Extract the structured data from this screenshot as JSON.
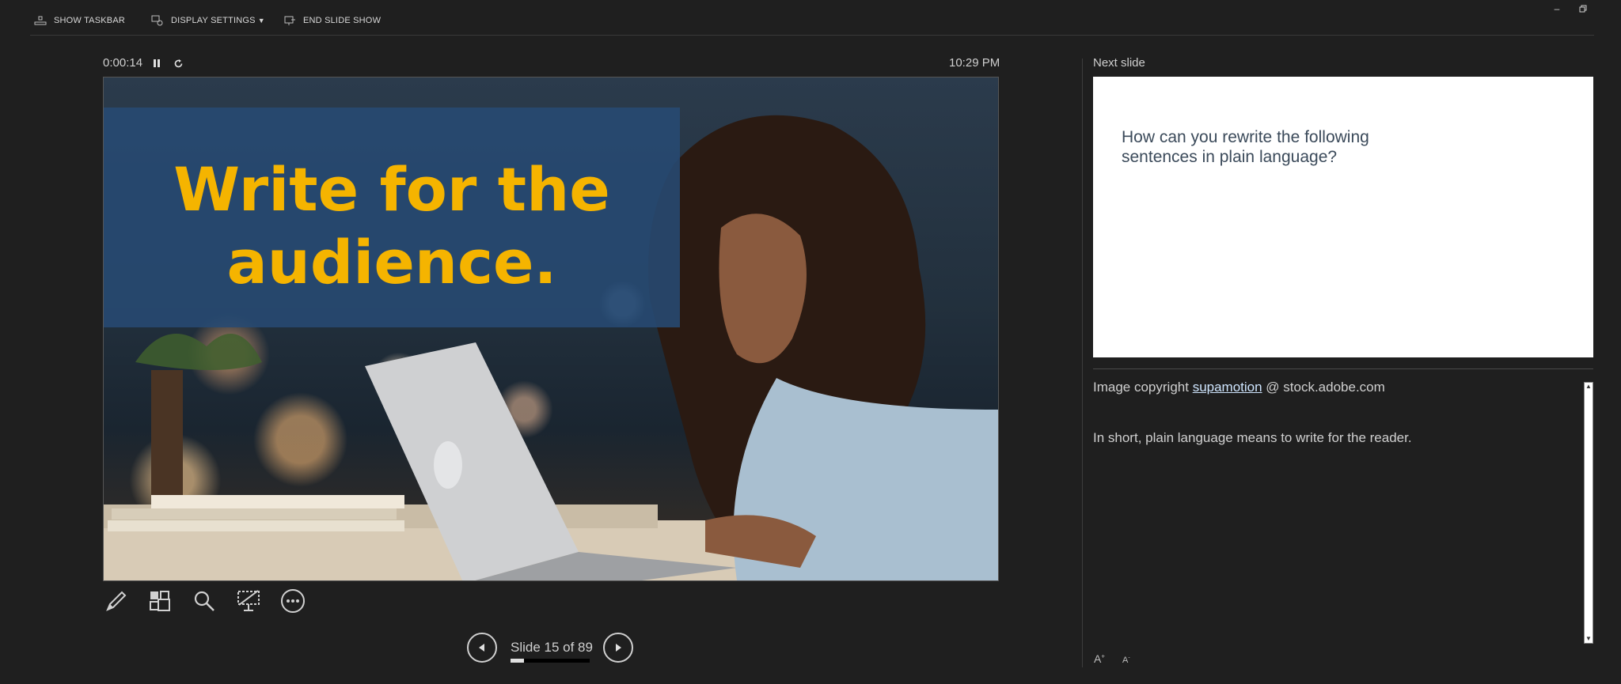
{
  "toolbar": {
    "show_taskbar": "SHOW TASKBAR",
    "display_settings": "DISPLAY SETTINGS",
    "end_slide_show": "END SLIDE SHOW"
  },
  "window_controls": [
    "minimize",
    "restore"
  ],
  "timer": {
    "elapsed": "0:00:14",
    "clock": "10:29 PM"
  },
  "current_slide": {
    "title": "Write for the\naudience.",
    "title_color": "#f5b400",
    "band_color": "#274a73"
  },
  "slide_tools": [
    "pen-icon",
    "see-all-slides-icon",
    "zoom-icon",
    "black-screen-icon",
    "more-options-icon"
  ],
  "navigation": {
    "slide_label": "Slide 15 of 89",
    "current": 15,
    "total": 89
  },
  "next_slide": {
    "label": "Next slide",
    "text": "How can you rewrite the following sentences in plain language?"
  },
  "notes": {
    "copyright_prefix": "Image copyright ",
    "copyright_link": "supamotion",
    "copyright_suffix": " @ stock.adobe.com",
    "line2": "In short, plain language means to write for the reader."
  },
  "font_controls": [
    "increase-font-icon",
    "decrease-font-icon"
  ]
}
